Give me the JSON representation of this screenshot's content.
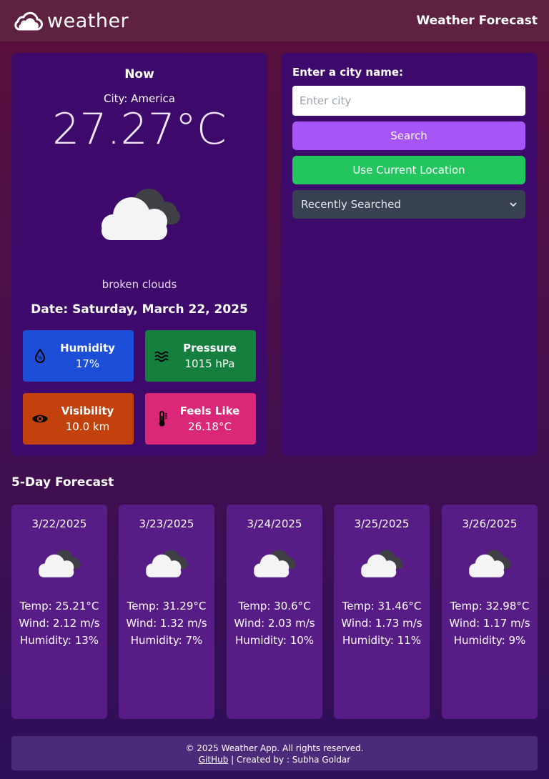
{
  "header": {
    "logo_text": "weather",
    "title": "Weather Forecast"
  },
  "now": {
    "title": "Now",
    "city": "City: America",
    "temperature": "27.27°C",
    "icon": "broken-clouds-icon",
    "description": "broken clouds",
    "date": "Date: Saturday, March 22, 2025",
    "stats": {
      "humidity": {
        "label": "Humidity",
        "value": "17%"
      },
      "pressure": {
        "label": "Pressure",
        "value": "1015 hPa"
      },
      "visibility": {
        "label": "Visibility",
        "value": "10.0 km"
      },
      "feels_like": {
        "label": "Feels Like",
        "value": "26.18°C"
      }
    }
  },
  "search": {
    "label": "Enter a city name:",
    "placeholder": "Enter city",
    "value": "",
    "search_button": "Search",
    "location_button": "Use Current Location",
    "recent_select": "Recently Searched"
  },
  "forecast": {
    "title": "5-Day Forecast",
    "days": [
      {
        "date": "3/22/2025",
        "temp": "Temp: 25.21°C",
        "wind": "Wind: 2.12 m/s",
        "humidity": "Humidity: 13%"
      },
      {
        "date": "3/23/2025",
        "temp": "Temp: 31.29°C",
        "wind": "Wind: 1.32 m/s",
        "humidity": "Humidity: 7%"
      },
      {
        "date": "3/24/2025",
        "temp": "Temp: 30.6°C",
        "wind": "Wind: 2.03 m/s",
        "humidity": "Humidity: 10%"
      },
      {
        "date": "3/25/2025",
        "temp": "Temp: 31.46°C",
        "wind": "Wind: 1.73 m/s",
        "humidity": "Humidity: 11%"
      },
      {
        "date": "3/26/2025",
        "temp": "Temp: 32.98°C",
        "wind": "Wind: 1.17 m/s",
        "humidity": "Humidity: 9%"
      }
    ]
  },
  "footer": {
    "copyright": "© 2025 Weather App. All rights reserved.",
    "github": "GitHub",
    "created_by": " | Created by : Subha Goldar"
  },
  "colors": {
    "header_bg": "#5e2140",
    "panel_bg": "#3d0a6b",
    "card_bg": "#581c87",
    "search_button": "#a855f7",
    "location_button": "#22c55e",
    "humidity": "#1d4ed8",
    "pressure": "#15803d",
    "visibility": "#c2410c",
    "feels_like": "#db2777"
  }
}
